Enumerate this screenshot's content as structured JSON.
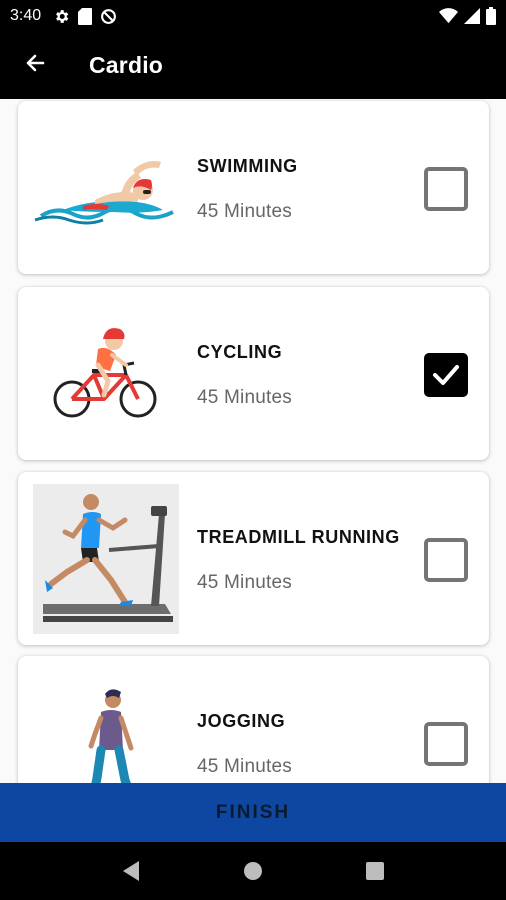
{
  "status_bar": {
    "time": "3:40",
    "left_icons": [
      "gear-icon",
      "sd-card-icon",
      "no-sim-icon"
    ],
    "right_icons": [
      "wifi-icon",
      "signal-icon",
      "battery-icon"
    ]
  },
  "app_bar": {
    "back_icon": "arrow-left-icon",
    "title": "Cardio"
  },
  "activities": [
    {
      "title": "SWIMMING",
      "duration": "45 Minutes",
      "checked": false,
      "image": "swimmer-illustration"
    },
    {
      "title": "CYCLING",
      "duration": "45 Minutes",
      "checked": true,
      "image": "cyclist-illustration"
    },
    {
      "title": "TREADMILL RUNNING",
      "duration": "45 Minutes",
      "checked": false,
      "image": "treadmill-runner-illustration"
    },
    {
      "title": "JOGGING",
      "duration": "45 Minutes",
      "checked": false,
      "image": "jogger-illustration"
    }
  ],
  "finish_button": {
    "label": "FINISH"
  },
  "nav_bar": {
    "back": "triangle-back-icon",
    "home": "circle-home-icon",
    "recents": "square-recents-icon"
  },
  "colors": {
    "app_bar_bg": "#000000",
    "finish_bg": "#0d47a1",
    "checkbox_border": "#757575",
    "checkbox_checked": "#000000",
    "duration_text": "#666666"
  }
}
